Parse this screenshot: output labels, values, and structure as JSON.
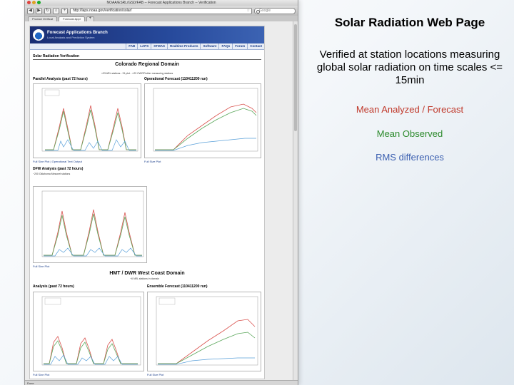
{
  "browser": {
    "window_title": "NOAA/ESRL/GSD/FAB -- Forecast Applications Branch -- Verification",
    "url": "http://laps.noaa.gov/verification/solar/",
    "search_placeholder": "Google",
    "tabs": [
      "Product Verificat",
      "Forecast Appl"
    ],
    "status": "Done"
  },
  "site": {
    "banner_title": "Forecast Applications Branch",
    "banner_subtitle": "Local Analysis and Prediction System",
    "nav": [
      "FAB",
      "LAPS",
      "STMAS",
      "Realtime Products",
      "Software",
      "FAQs",
      "Forum",
      "Contact"
    ],
    "section_title": "Solar Radiation Verification",
    "colorado": {
      "title": "Colorado Regional Domain",
      "note": "<33 ARL stations - 31 plot - >23 CWOP/other measuring stations",
      "left_label": "Parallel Analysis (past 72 hours)",
      "right_label": "Operational Forecast (110411200 run)",
      "left_link": "Full Size Plot | Operational Text Output",
      "right_link": "Full Size Plot"
    },
    "dfw": {
      "label": "DFW Analysis (past 72 hours)",
      "note": "~200 Oklahoma Mesonet stations",
      "link": "Full Size Plot"
    },
    "hmt": {
      "title": "HMT / DWR West Coast Domain",
      "note": "~6 NRL stations in domain",
      "left_label": "Analysis (past 72 hours)",
      "right_label": "Ensemble Forecast (110411200 run)",
      "left_link": "Full Size Plot",
      "right_link": "Full Size Plot"
    }
  },
  "slide": {
    "title": "Solar Radiation Web Page",
    "body": "Verified at station locations measuring global solar radiation on time scales <= 15min",
    "legend": [
      {
        "text": "Mean Analyzed / Forecast",
        "color": "#c0392b"
      },
      {
        "text": "Mean Observed",
        "color": "#2e8b2e"
      },
      {
        "text": "RMS differences",
        "color": "#3b5fb0"
      }
    ]
  },
  "colors": {
    "analyzed": "#d9534f",
    "observed": "#5aa65a",
    "rms": "#5aa0d9",
    "banner": "#274a9c"
  }
}
